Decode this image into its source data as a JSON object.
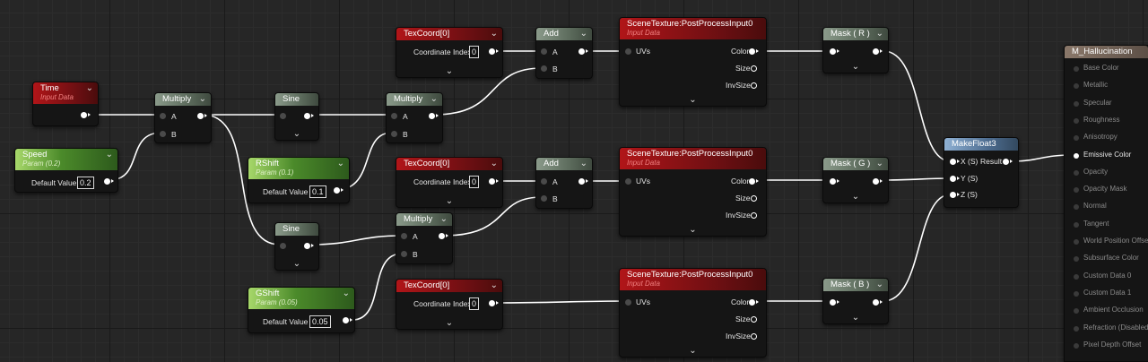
{
  "nodes": {
    "time": {
      "title": "Time",
      "subtitle": "Input Data"
    },
    "speed": {
      "title": "Speed",
      "subtitle": "Param (0.2)",
      "value_label": "Default Value",
      "value": "0.2"
    },
    "multiply1": {
      "title": "Multiply",
      "pin_a": "A",
      "pin_b": "B"
    },
    "sine1": {
      "title": "Sine"
    },
    "rshift": {
      "title": "RShift",
      "subtitle": "Param (0.1)",
      "value_label": "Default Value",
      "value": "0.1"
    },
    "sine2": {
      "title": "Sine"
    },
    "gshift": {
      "title": "GShift",
      "subtitle": "Param (0.05)",
      "value_label": "Default Value",
      "value": "0.05"
    },
    "multiply2": {
      "title": "Multiply",
      "pin_a": "A",
      "pin_b": "B"
    },
    "multiply3": {
      "title": "Multiply",
      "pin_a": "A",
      "pin_b": "B"
    },
    "texcoord1": {
      "title": "TexCoord[0]",
      "label": "Coordinate Index",
      "value": "0"
    },
    "texcoord2": {
      "title": "TexCoord[0]",
      "label": "Coordinate Index",
      "value": "0"
    },
    "texcoord3": {
      "title": "TexCoord[0]",
      "label": "Coordinate Index",
      "value": "0"
    },
    "add1": {
      "title": "Add",
      "pin_a": "A",
      "pin_b": "B"
    },
    "add2": {
      "title": "Add",
      "pin_a": "A",
      "pin_b": "B"
    },
    "scenetex1": {
      "title": "SceneTexture:PostProcessInput0",
      "subtitle": "Input Data",
      "in_uvs": "UVs",
      "out_color": "Color",
      "out_size": "Size",
      "out_invsize": "InvSize"
    },
    "scenetex2": {
      "title": "SceneTexture:PostProcessInput0",
      "subtitle": "Input Data",
      "in_uvs": "UVs",
      "out_color": "Color",
      "out_size": "Size",
      "out_invsize": "InvSize"
    },
    "scenetex3": {
      "title": "SceneTexture:PostProcessInput0",
      "subtitle": "Input Data",
      "in_uvs": "UVs",
      "out_color": "Color",
      "out_size": "Size",
      "out_invsize": "InvSize"
    },
    "maskr": {
      "title": "Mask ( R )"
    },
    "maskg": {
      "title": "Mask ( G )"
    },
    "maskb": {
      "title": "Mask ( B )"
    },
    "makefloat3": {
      "title": "MakeFloat3",
      "pin_x": "X (S)",
      "pin_y": "Y (S)",
      "pin_z": "Z (S)",
      "out_result": "Result"
    }
  },
  "material": {
    "title": "M_Hallucination",
    "pins": [
      "Base Color",
      "Metallic",
      "Specular",
      "Roughness",
      "Anisotropy",
      "Emissive Color",
      "Opacity",
      "Opacity Mask",
      "Normal",
      "Tangent",
      "World Position Offset",
      "Subsurface Color",
      "Custom Data 0",
      "Custom Data 1",
      "Ambient Occlusion",
      "Refraction (Disabled)",
      "Pixel Depth Offset"
    ],
    "active_pin": "Emissive Color"
  },
  "colors": {
    "input_data_header": "#b11518",
    "param_header": "#4b8a2a",
    "math_header": "#5c6b5c",
    "makefloat_header": "#4d6c8f",
    "material_header": "#5c4f46",
    "wire": "#ffffff"
  },
  "icons": {
    "collapse": "chevron-down-icon",
    "output_pin": "filled-circle-arrow",
    "input_pin": "dim-circle"
  }
}
